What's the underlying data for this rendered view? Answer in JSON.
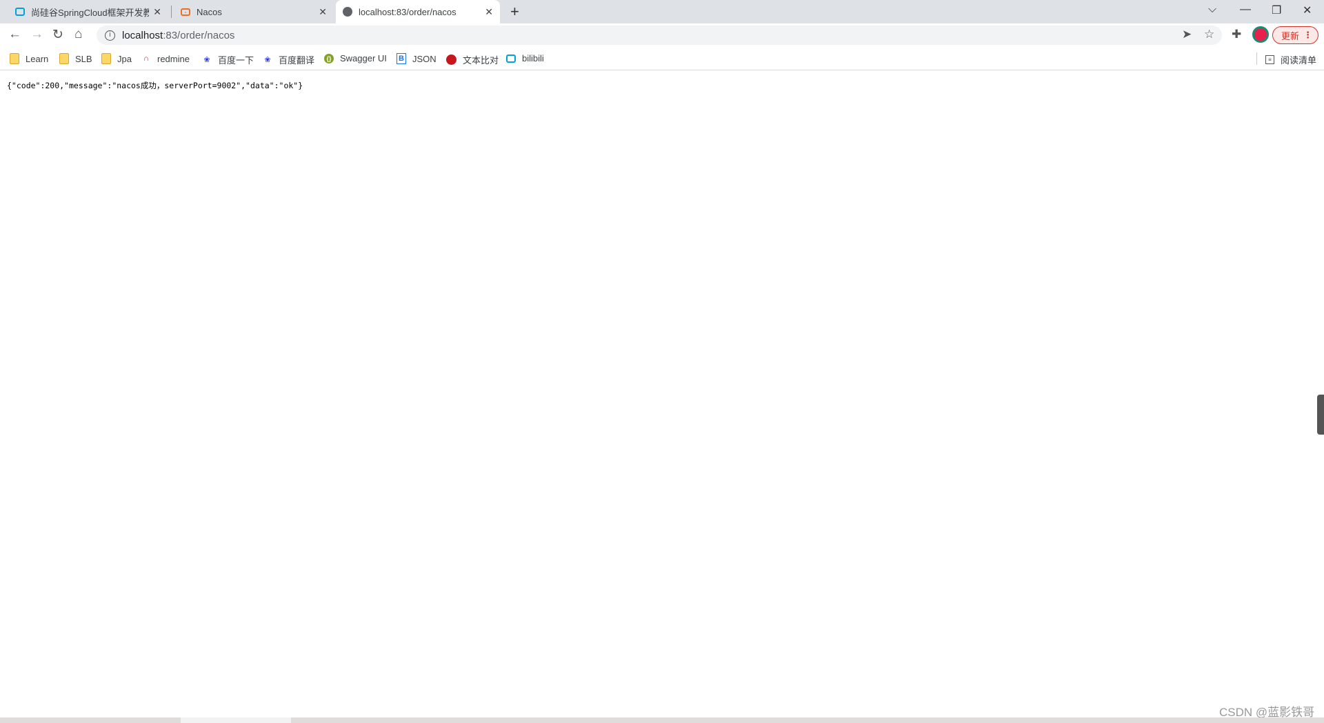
{
  "tabs": [
    {
      "title": "尚硅谷SpringCloud框架开发教程",
      "icon": "bilibili-icon",
      "active": false
    },
    {
      "title": "Nacos",
      "icon": "nacos-icon",
      "active": false
    },
    {
      "title": "localhost:83/order/nacos",
      "icon": "globe-icon",
      "active": true
    }
  ],
  "address": {
    "url_host": "localhost",
    "url_rest": ":83/order/nacos"
  },
  "toolbar": {
    "update_label": "更新"
  },
  "bookmarks": [
    {
      "label": "Learn",
      "icon": "folder-icon"
    },
    {
      "label": "SLB",
      "icon": "folder-icon"
    },
    {
      "label": "Jpa",
      "icon": "folder-icon"
    },
    {
      "label": "redmine",
      "icon": "redmine-icon"
    },
    {
      "label": "百度一下",
      "icon": "baidu-icon"
    },
    {
      "label": "百度翻译",
      "icon": "baidu-icon"
    },
    {
      "label": "Swagger UI",
      "icon": "swagger-icon"
    },
    {
      "label": "JSON",
      "icon": "json-icon"
    },
    {
      "label": "文本比对",
      "icon": "diff-icon"
    },
    {
      "label": "bilibili",
      "icon": "bilibili-icon"
    }
  ],
  "reading_list": "阅读清单",
  "page_body": "{\"code\":200,\"message\":\"nacos成功，serverPort=9002\",\"data\":\"ok\"}",
  "watermark": "CSDN @蓝影铁哥",
  "colors": {
    "tabbar": "#dee1e6",
    "update": "#d93025",
    "folder": "#fcd667"
  }
}
